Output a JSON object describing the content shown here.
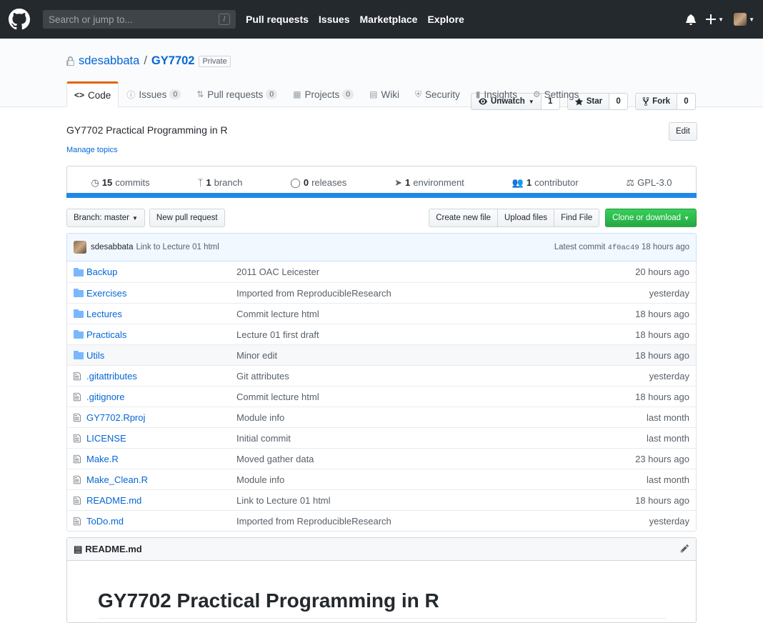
{
  "header": {
    "search_placeholder": "Search or jump to...",
    "search_key": "/",
    "nav": [
      "Pull requests",
      "Issues",
      "Marketplace",
      "Explore"
    ]
  },
  "repo": {
    "owner": "sdesabbata",
    "separator": "/",
    "name": "GY7702",
    "visibility": "Private",
    "actions": {
      "watch_label": "Unwatch",
      "watch_count": "1",
      "star_label": "Star",
      "star_count": "0",
      "fork_label": "Fork",
      "fork_count": "0"
    },
    "tabs": [
      {
        "label": "Code",
        "icon": "code-icon"
      },
      {
        "label": "Issues",
        "count": "0",
        "icon": "issue-icon"
      },
      {
        "label": "Pull requests",
        "count": "0",
        "icon": "pull-request-icon"
      },
      {
        "label": "Projects",
        "count": "0",
        "icon": "project-icon"
      },
      {
        "label": "Wiki",
        "icon": "book-icon"
      },
      {
        "label": "Security",
        "icon": "shield-icon"
      },
      {
        "label": "Insights",
        "icon": "graph-icon"
      },
      {
        "label": "Settings",
        "icon": "gear-icon"
      }
    ]
  },
  "about": {
    "description": "GY7702 Practical Programming in R",
    "edit": "Edit",
    "manage_topics": "Manage topics"
  },
  "summary": {
    "commits_num": "15",
    "commits_label": "commits",
    "branches_num": "1",
    "branches_label": "branch",
    "releases_num": "0",
    "releases_label": "releases",
    "env_num": "1",
    "env_label": "environment",
    "contrib_num": "1",
    "contrib_label": "contributor",
    "license": "GPL-3.0"
  },
  "filebar": {
    "branch": "Branch: master",
    "new_pr": "New pull request",
    "create_file": "Create new file",
    "upload": "Upload files",
    "find": "Find File",
    "clone": "Clone or download"
  },
  "commit": {
    "author": "sdesabbata",
    "message": "Link to Lecture 01 html",
    "latest_label": "Latest commit",
    "sha": "4f0ac49",
    "age": "18 hours ago"
  },
  "files": [
    {
      "name": "Backup",
      "type": "dir",
      "message": "2011 OAC Leicester",
      "age": "20 hours ago"
    },
    {
      "name": "Exercises",
      "type": "dir",
      "message": "Imported from ReproducibleResearch",
      "age": "yesterday"
    },
    {
      "name": "Lectures",
      "type": "dir",
      "message": "Commit lecture html",
      "age": "18 hours ago"
    },
    {
      "name": "Practicals",
      "type": "dir",
      "message": "Lecture 01 first draft",
      "age": "18 hours ago"
    },
    {
      "name": "Utils",
      "type": "dir",
      "message": "Minor edit",
      "age": "18 hours ago"
    },
    {
      "name": ".gitattributes",
      "type": "file",
      "message": "Git attributes",
      "age": "yesterday"
    },
    {
      "name": ".gitignore",
      "type": "file",
      "message": "Commit lecture html",
      "age": "18 hours ago"
    },
    {
      "name": "GY7702.Rproj",
      "type": "file",
      "message": "Module info",
      "age": "last month"
    },
    {
      "name": "LICENSE",
      "type": "file",
      "message": "Initial commit",
      "age": "last month"
    },
    {
      "name": "Make.R",
      "type": "file",
      "message": "Moved gather data",
      "age": "23 hours ago"
    },
    {
      "name": "Make_Clean.R",
      "type": "file",
      "message": "Module info",
      "age": "last month"
    },
    {
      "name": "README.md",
      "type": "file",
      "message": "Link to Lecture 01 html",
      "age": "18 hours ago"
    },
    {
      "name": "ToDo.md",
      "type": "file",
      "message": "Imported from ReproducibleResearch",
      "age": "yesterday"
    }
  ],
  "readme": {
    "filename": "README.md",
    "heading": "GY7702 Practical Programming in R"
  },
  "colors": {
    "header_bg": "#24292e",
    "link": "#0366d6",
    "tab_accent": "#e36209",
    "language_bar": "#2188e5",
    "clone_green": "#28a745"
  }
}
